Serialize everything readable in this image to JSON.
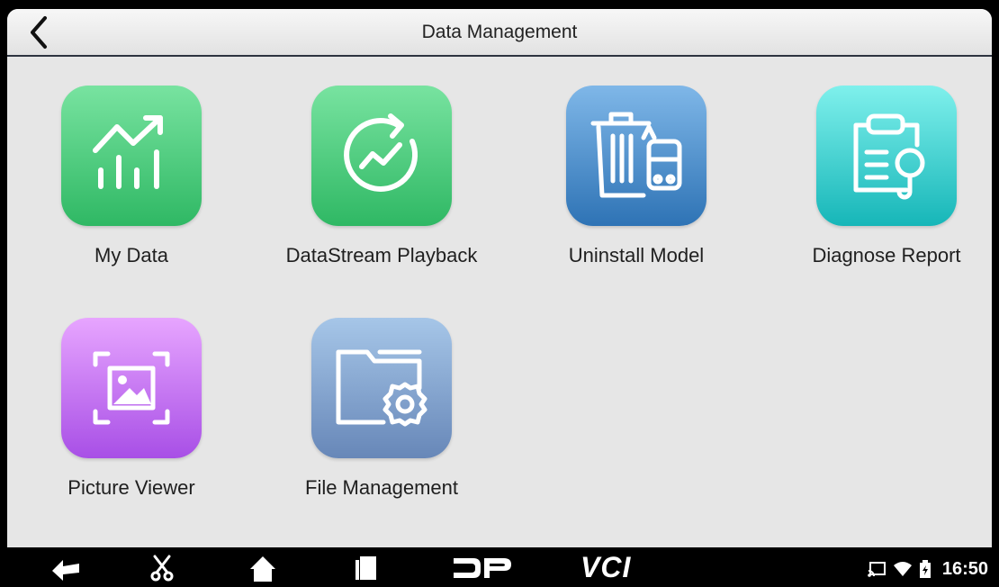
{
  "header": {
    "title": "Data Management",
    "back_icon": "chevron-left-icon"
  },
  "apps": [
    {
      "label": "My Data",
      "icon": "bar-chart-trend-icon"
    },
    {
      "label": "DataStream Playback",
      "icon": "playback-trend-icon"
    },
    {
      "label": "Uninstall Model",
      "icon": "trash-car-icon"
    },
    {
      "label": "Diagnose Report",
      "icon": "clipboard-search-icon"
    },
    {
      "label": "Picture Viewer",
      "icon": "image-frame-icon"
    },
    {
      "label": "File Management",
      "icon": "folder-gear-icon"
    }
  ],
  "navbar": {
    "buttons": [
      "back-arrow-icon",
      "scissors-icon",
      "home-icon",
      "recent-apps-icon",
      "dp-logo-icon",
      "vci-icon"
    ],
    "vci_text": "VCI",
    "dp_text": "DP"
  },
  "status_bar": {
    "time": "16:50",
    "icons": [
      "cast-icon",
      "wifi-icon",
      "battery-icon"
    ]
  }
}
